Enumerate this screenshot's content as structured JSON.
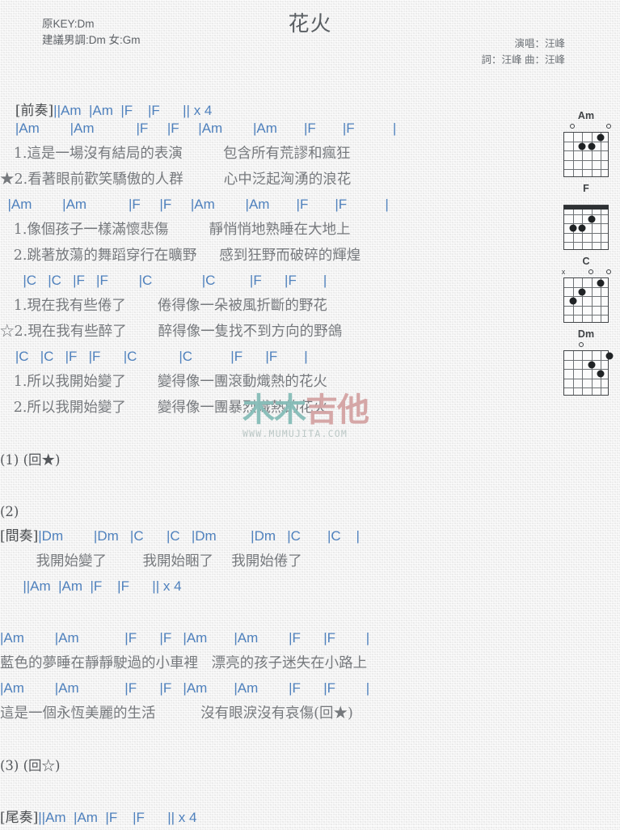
{
  "header": {
    "key_original": "原KEY:Dm",
    "key_suggested": "建議男調:Dm 女:Gm",
    "title": "花火",
    "singer": "演唱：汪峰",
    "writers": "詞：汪峰  曲：汪峰"
  },
  "watermark": {
    "text_part1": "木木",
    "text_part2": "吉他",
    "url": "WWW.MUMUJITA.COM",
    "color_teal": "#86bdb8",
    "color_pink": "#d4a3a3"
  },
  "colors": {
    "chord": "#4f81bd",
    "lyric": "#76797d",
    "bar": "#6b6a3a",
    "page_bg": "#f2f2f2"
  },
  "sheet": {
    "intro_label": "[前奏]",
    "intro_chords": "||Am  |Am  |F    |F      || x 4",
    "interlude_label": "[間奏]",
    "outro_label": "[尾奏]",
    "outro_chords": "||Am  |Am  |F    |F      || x 4",
    "lines": [
      {
        "id": "l1",
        "type": "spacer",
        "text": ""
      },
      {
        "id": "l2",
        "type": "chord",
        "text": "    |Am        |Am           |F     |F     |Am        |Am       |F       |F          |"
      },
      {
        "id": "l3",
        "type": "lyric",
        "text": "   1.這是一場沒有結局的表演         包含所有荒謬和瘋狂"
      },
      {
        "id": "l4",
        "type": "lyric",
        "text": "★2.看著眼前歡笑驕傲的人群         心中泛起洶湧的浪花"
      },
      {
        "id": "l5",
        "type": "chord",
        "text": "  |Am        |Am           |F     |F     |Am        |Am       |F       |F          |"
      },
      {
        "id": "l6",
        "type": "lyric",
        "text": "   1.像個孩子一樣滿懷悲傷         靜悄悄地熟睡在大地上"
      },
      {
        "id": "l7",
        "type": "lyric",
        "text": "   2.跳著放蕩的舞蹈穿行在曠野     感到狂野而破碎的輝煌"
      },
      {
        "id": "l8",
        "type": "chord",
        "text": "      |C   |C   |F   |F        |C             |C         |F      |F       |"
      },
      {
        "id": "l9",
        "type": "lyric",
        "text": "   1.現在我有些倦了       倦得像一朵被風折斷的野花"
      },
      {
        "id": "l10",
        "type": "lyric",
        "text": "☆2.現在我有些醉了       醉得像一隻找不到方向的野鴿"
      },
      {
        "id": "l11",
        "type": "chord",
        "text": "    |C   |C   |F   |F      |C           |C          |F      |F       |"
      },
      {
        "id": "l12",
        "type": "lyric",
        "text": "   1.所以我開始變了       變得像一團滾動熾熱的花火"
      },
      {
        "id": "l13",
        "type": "lyric",
        "text": "   2.所以我開始變了       變得像一團暴烈熾熱的花火"
      },
      {
        "id": "l14",
        "type": "spacer-lg",
        "text": ""
      },
      {
        "id": "l15",
        "type": "plain",
        "text": "(1) (回★)"
      },
      {
        "id": "l16",
        "type": "spacer-lg",
        "text": ""
      },
      {
        "id": "l17",
        "type": "plain",
        "text": "(2)"
      },
      {
        "id": "l18",
        "type": "interlude",
        "text": "|Dm        |Dm   |C      |C   |Dm         |Dm   |C       |C    |"
      },
      {
        "id": "l19",
        "type": "lyric",
        "text": "        我開始變了        我開始睏了    我開始倦了"
      },
      {
        "id": "l20",
        "type": "chord",
        "text": "      ||Am  |Am  |F    |F      || x 4"
      },
      {
        "id": "l21",
        "type": "spacer-lg",
        "text": ""
      },
      {
        "id": "l22",
        "type": "chord",
        "text": "|Am        |Am            |F      |F   |Am       |Am        |F      |F        |"
      },
      {
        "id": "l23",
        "type": "lyric",
        "text": "藍色的夢睡在靜靜駛過的小車裡   漂亮的孩子迷失在小路上"
      },
      {
        "id": "l24",
        "type": "chord",
        "text": "|Am        |Am            |F      |F   |Am       |Am        |F      |F        |"
      },
      {
        "id": "l25",
        "type": "lyric",
        "text": "這是一個永恆美麗的生活          沒有眼淚沒有哀傷(回★)"
      },
      {
        "id": "l26",
        "type": "spacer-lg",
        "text": ""
      },
      {
        "id": "l27",
        "type": "plain",
        "text": "(3) (回☆)"
      },
      {
        "id": "l28",
        "type": "spacer-lg",
        "text": ""
      }
    ]
  },
  "diagrams": [
    {
      "name": "Am",
      "markers": [
        {
          "kind": "o",
          "string": 5
        },
        {
          "kind": "o",
          "string": 1
        }
      ],
      "dots": [
        {
          "string": 2,
          "fret": 1
        },
        {
          "string": 4,
          "fret": 2
        },
        {
          "string": 3,
          "fret": 2
        }
      ],
      "barre": null
    },
    {
      "name": "F",
      "markers": [],
      "dots": [
        {
          "string": 3,
          "fret": 2
        },
        {
          "string": 5,
          "fret": 3
        },
        {
          "string": 4,
          "fret": 3
        }
      ],
      "barre": {
        "fret": 1
      }
    },
    {
      "name": "C",
      "markers": [
        {
          "kind": "x",
          "string": 6
        },
        {
          "kind": "o",
          "string": 3
        },
        {
          "kind": "o",
          "string": 1
        }
      ],
      "dots": [
        {
          "string": 2,
          "fret": 1
        },
        {
          "string": 4,
          "fret": 2
        },
        {
          "string": 5,
          "fret": 3
        }
      ],
      "barre": null
    },
    {
      "name": "Dm",
      "markers": [
        {
          "kind": "o",
          "string": 4
        }
      ],
      "dots": [
        {
          "string": 1,
          "fret": 1
        },
        {
          "string": 3,
          "fret": 2
        },
        {
          "string": 2,
          "fret": 3
        }
      ],
      "barre": null
    }
  ]
}
